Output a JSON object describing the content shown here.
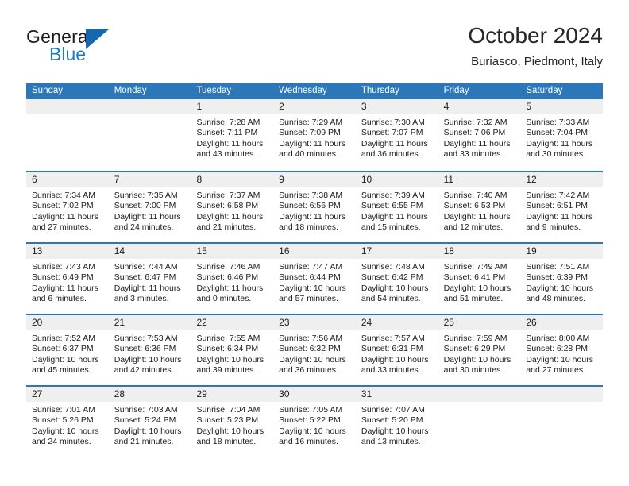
{
  "brand": {
    "name_top": "General",
    "name_bottom": "Blue",
    "flag_icon": "blue-triangle-flag",
    "colors": {
      "text": "#1c1c1c",
      "blue": "#1f7ac4",
      "flag": "#1567b0"
    }
  },
  "header": {
    "title": "October 2024",
    "subtitle": "Buriasco, Piedmont, Italy"
  },
  "theme": {
    "header_blue": "#2b77ba",
    "band_gray": "#efefef",
    "text": "#1c1c1c"
  },
  "calendar": {
    "weekdays": [
      "Sunday",
      "Monday",
      "Tuesday",
      "Wednesday",
      "Thursday",
      "Friday",
      "Saturday"
    ],
    "labels": {
      "sunrise": "Sunrise:",
      "sunset": "Sunset:",
      "daylight": "Daylight:"
    },
    "weeks": [
      [
        {
          "day": ""
        },
        {
          "day": ""
        },
        {
          "day": "1",
          "sunrise": "Sunrise: 7:28 AM",
          "sunset": "Sunset: 7:11 PM",
          "daylight1": "Daylight: 11 hours",
          "daylight2": "and 43 minutes."
        },
        {
          "day": "2",
          "sunrise": "Sunrise: 7:29 AM",
          "sunset": "Sunset: 7:09 PM",
          "daylight1": "Daylight: 11 hours",
          "daylight2": "and 40 minutes."
        },
        {
          "day": "3",
          "sunrise": "Sunrise: 7:30 AM",
          "sunset": "Sunset: 7:07 PM",
          "daylight1": "Daylight: 11 hours",
          "daylight2": "and 36 minutes."
        },
        {
          "day": "4",
          "sunrise": "Sunrise: 7:32 AM",
          "sunset": "Sunset: 7:06 PM",
          "daylight1": "Daylight: 11 hours",
          "daylight2": "and 33 minutes."
        },
        {
          "day": "5",
          "sunrise": "Sunrise: 7:33 AM",
          "sunset": "Sunset: 7:04 PM",
          "daylight1": "Daylight: 11 hours",
          "daylight2": "and 30 minutes."
        }
      ],
      [
        {
          "day": "6",
          "sunrise": "Sunrise: 7:34 AM",
          "sunset": "Sunset: 7:02 PM",
          "daylight1": "Daylight: 11 hours",
          "daylight2": "and 27 minutes."
        },
        {
          "day": "7",
          "sunrise": "Sunrise: 7:35 AM",
          "sunset": "Sunset: 7:00 PM",
          "daylight1": "Daylight: 11 hours",
          "daylight2": "and 24 minutes."
        },
        {
          "day": "8",
          "sunrise": "Sunrise: 7:37 AM",
          "sunset": "Sunset: 6:58 PM",
          "daylight1": "Daylight: 11 hours",
          "daylight2": "and 21 minutes."
        },
        {
          "day": "9",
          "sunrise": "Sunrise: 7:38 AM",
          "sunset": "Sunset: 6:56 PM",
          "daylight1": "Daylight: 11 hours",
          "daylight2": "and 18 minutes."
        },
        {
          "day": "10",
          "sunrise": "Sunrise: 7:39 AM",
          "sunset": "Sunset: 6:55 PM",
          "daylight1": "Daylight: 11 hours",
          "daylight2": "and 15 minutes."
        },
        {
          "day": "11",
          "sunrise": "Sunrise: 7:40 AM",
          "sunset": "Sunset: 6:53 PM",
          "daylight1": "Daylight: 11 hours",
          "daylight2": "and 12 minutes."
        },
        {
          "day": "12",
          "sunrise": "Sunrise: 7:42 AM",
          "sunset": "Sunset: 6:51 PM",
          "daylight1": "Daylight: 11 hours",
          "daylight2": "and 9 minutes."
        }
      ],
      [
        {
          "day": "13",
          "sunrise": "Sunrise: 7:43 AM",
          "sunset": "Sunset: 6:49 PM",
          "daylight1": "Daylight: 11 hours",
          "daylight2": "and 6 minutes."
        },
        {
          "day": "14",
          "sunrise": "Sunrise: 7:44 AM",
          "sunset": "Sunset: 6:47 PM",
          "daylight1": "Daylight: 11 hours",
          "daylight2": "and 3 minutes."
        },
        {
          "day": "15",
          "sunrise": "Sunrise: 7:46 AM",
          "sunset": "Sunset: 6:46 PM",
          "daylight1": "Daylight: 11 hours",
          "daylight2": "and 0 minutes."
        },
        {
          "day": "16",
          "sunrise": "Sunrise: 7:47 AM",
          "sunset": "Sunset: 6:44 PM",
          "daylight1": "Daylight: 10 hours",
          "daylight2": "and 57 minutes."
        },
        {
          "day": "17",
          "sunrise": "Sunrise: 7:48 AM",
          "sunset": "Sunset: 6:42 PM",
          "daylight1": "Daylight: 10 hours",
          "daylight2": "and 54 minutes."
        },
        {
          "day": "18",
          "sunrise": "Sunrise: 7:49 AM",
          "sunset": "Sunset: 6:41 PM",
          "daylight1": "Daylight: 10 hours",
          "daylight2": "and 51 minutes."
        },
        {
          "day": "19",
          "sunrise": "Sunrise: 7:51 AM",
          "sunset": "Sunset: 6:39 PM",
          "daylight1": "Daylight: 10 hours",
          "daylight2": "and 48 minutes."
        }
      ],
      [
        {
          "day": "20",
          "sunrise": "Sunrise: 7:52 AM",
          "sunset": "Sunset: 6:37 PM",
          "daylight1": "Daylight: 10 hours",
          "daylight2": "and 45 minutes."
        },
        {
          "day": "21",
          "sunrise": "Sunrise: 7:53 AM",
          "sunset": "Sunset: 6:36 PM",
          "daylight1": "Daylight: 10 hours",
          "daylight2": "and 42 minutes."
        },
        {
          "day": "22",
          "sunrise": "Sunrise: 7:55 AM",
          "sunset": "Sunset: 6:34 PM",
          "daylight1": "Daylight: 10 hours",
          "daylight2": "and 39 minutes."
        },
        {
          "day": "23",
          "sunrise": "Sunrise: 7:56 AM",
          "sunset": "Sunset: 6:32 PM",
          "daylight1": "Daylight: 10 hours",
          "daylight2": "and 36 minutes."
        },
        {
          "day": "24",
          "sunrise": "Sunrise: 7:57 AM",
          "sunset": "Sunset: 6:31 PM",
          "daylight1": "Daylight: 10 hours",
          "daylight2": "and 33 minutes."
        },
        {
          "day": "25",
          "sunrise": "Sunrise: 7:59 AM",
          "sunset": "Sunset: 6:29 PM",
          "daylight1": "Daylight: 10 hours",
          "daylight2": "and 30 minutes."
        },
        {
          "day": "26",
          "sunrise": "Sunrise: 8:00 AM",
          "sunset": "Sunset: 6:28 PM",
          "daylight1": "Daylight: 10 hours",
          "daylight2": "and 27 minutes."
        }
      ],
      [
        {
          "day": "27",
          "sunrise": "Sunrise: 7:01 AM",
          "sunset": "Sunset: 5:26 PM",
          "daylight1": "Daylight: 10 hours",
          "daylight2": "and 24 minutes."
        },
        {
          "day": "28",
          "sunrise": "Sunrise: 7:03 AM",
          "sunset": "Sunset: 5:24 PM",
          "daylight1": "Daylight: 10 hours",
          "daylight2": "and 21 minutes."
        },
        {
          "day": "29",
          "sunrise": "Sunrise: 7:04 AM",
          "sunset": "Sunset: 5:23 PM",
          "daylight1": "Daylight: 10 hours",
          "daylight2": "and 18 minutes."
        },
        {
          "day": "30",
          "sunrise": "Sunrise: 7:05 AM",
          "sunset": "Sunset: 5:22 PM",
          "daylight1": "Daylight: 10 hours",
          "daylight2": "and 16 minutes."
        },
        {
          "day": "31",
          "sunrise": "Sunrise: 7:07 AM",
          "sunset": "Sunset: 5:20 PM",
          "daylight1": "Daylight: 10 hours",
          "daylight2": "and 13 minutes."
        },
        {
          "day": ""
        },
        {
          "day": ""
        }
      ]
    ]
  }
}
